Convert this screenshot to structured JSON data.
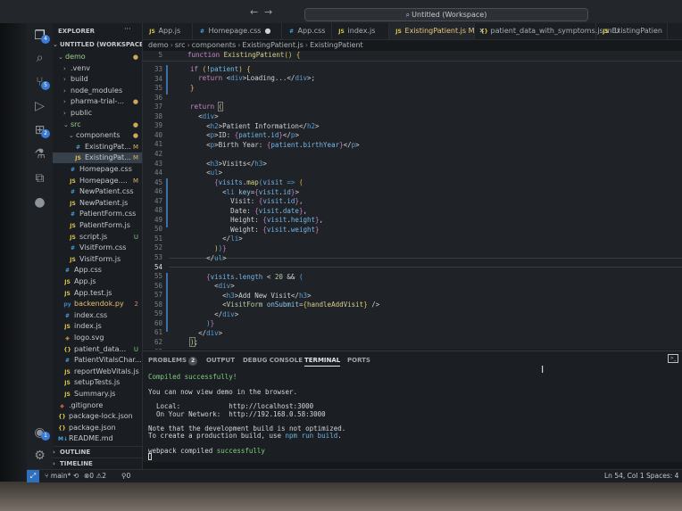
{
  "window": {
    "title": "Untitled (Workspace)"
  },
  "activity_bar": {
    "items": [
      {
        "icon": "files-icon",
        "badge": "4"
      },
      {
        "icon": "search-icon"
      },
      {
        "icon": "source-control-icon",
        "badge": "5"
      },
      {
        "icon": "run-debug-icon"
      },
      {
        "icon": "extensions-icon",
        "badge": "2"
      },
      {
        "icon": "testing-icon"
      },
      {
        "icon": "remote-explorer-icon"
      },
      {
        "icon": "github-icon"
      },
      {
        "icon": "accounts-icon",
        "badge": "1"
      },
      {
        "icon": "manage-gear-icon"
      }
    ]
  },
  "explorer": {
    "header": "EXPLORER",
    "more": "···",
    "workspace": "UNTITLED (WORKSPACE)",
    "tree": [
      {
        "label": "demo",
        "kind": "folder-open",
        "indent": 1,
        "status": "●",
        "status_kind": "dot",
        "highlight": true
      },
      {
        "label": ".venv",
        "kind": "folder",
        "indent": 2
      },
      {
        "label": "build",
        "kind": "folder",
        "indent": 2
      },
      {
        "label": "node_modules",
        "kind": "folder",
        "indent": 2
      },
      {
        "label": "pharma-trial-...",
        "kind": "folder",
        "indent": 2,
        "status": "●",
        "status_kind": "dot"
      },
      {
        "label": "public",
        "kind": "folder",
        "indent": 2
      },
      {
        "label": "src",
        "kind": "folder-open",
        "indent": 2,
        "status": "●",
        "status_kind": "dot",
        "highlight": true
      },
      {
        "label": "components",
        "kind": "folder-open",
        "indent": 3,
        "status": "●",
        "status_kind": "dot"
      },
      {
        "label": "ExistingPat...",
        "file": "css",
        "indent": 4,
        "status": "M",
        "status_kind": "m"
      },
      {
        "label": "ExistingPat...",
        "file": "js",
        "indent": 4,
        "status": "M",
        "status_kind": "m",
        "selected": true
      },
      {
        "label": "Homepage.css",
        "file": "css",
        "indent": 3
      },
      {
        "label": "Homepage....",
        "file": "js",
        "indent": 3,
        "status": "M",
        "status_kind": "m"
      },
      {
        "label": "NewPatient.css",
        "file": "css",
        "indent": 3
      },
      {
        "label": "NewPatient.js",
        "file": "js",
        "indent": 3
      },
      {
        "label": "PatientForm.css",
        "file": "css",
        "indent": 3
      },
      {
        "label": "PatientForm.js",
        "file": "js",
        "indent": 3
      },
      {
        "label": "script.js",
        "file": "js",
        "indent": 3,
        "status": "U",
        "status_kind": "u"
      },
      {
        "label": "VisitForm.css",
        "file": "css",
        "indent": 3
      },
      {
        "label": "VisitForm.js",
        "file": "js",
        "indent": 3
      },
      {
        "label": "App.css",
        "file": "css",
        "indent": 2
      },
      {
        "label": "App.js",
        "file": "js",
        "indent": 2
      },
      {
        "label": "App.test.js",
        "file": "js",
        "indent": 2
      },
      {
        "label": "backendok.py",
        "file": "py",
        "indent": 2,
        "status": "2",
        "status_kind": "err",
        "highlight": true
      },
      {
        "label": "index.css",
        "file": "css",
        "indent": 2
      },
      {
        "label": "index.js",
        "file": "js",
        "indent": 2
      },
      {
        "label": "logo.svg",
        "file": "svg",
        "indent": 2
      },
      {
        "label": "patient_data...",
        "file": "json",
        "indent": 2,
        "status": "U",
        "status_kind": "u"
      },
      {
        "label": "PatientVitalsChar...",
        "file": "css",
        "indent": 2
      },
      {
        "label": "reportWebVitals.js",
        "file": "js",
        "indent": 2
      },
      {
        "label": "setupTests.js",
        "file": "js",
        "indent": 2
      },
      {
        "label": "Summary.js",
        "file": "js",
        "indent": 2
      },
      {
        "label": ".gitignore",
        "file": "git",
        "indent": 1
      },
      {
        "label": "package-lock.json",
        "file": "json",
        "indent": 1
      },
      {
        "label": "package.json",
        "file": "json",
        "indent": 1
      },
      {
        "label": "README.md",
        "file": "md",
        "indent": 1
      }
    ],
    "outline": "OUTLINE",
    "timeline": "TIMELINE"
  },
  "tabs": [
    {
      "label": "App.js",
      "file": "js"
    },
    {
      "label": "Homepage.css",
      "file": "css",
      "modified": "●"
    },
    {
      "label": "App.css",
      "file": "css"
    },
    {
      "label": "index.js",
      "file": "js"
    },
    {
      "label": "ExistingPatient.js M",
      "file": "js",
      "active": true,
      "close": "✕"
    },
    {
      "label": "patient_data_with_symptoms.json U",
      "file": "json"
    },
    {
      "label": "ExistingPatien",
      "file": "js"
    }
  ],
  "breadcrumb": {
    "parts": [
      "demo",
      "src",
      "components",
      "ExistingPatient.js",
      "ExistingPatient"
    ]
  },
  "editor": {
    "sticky_line_number": "5",
    "sticky_code": "function ExistingPatient() {",
    "line_numbers": [
      "33",
      "34",
      "35",
      "36",
      "37",
      "38",
      "39",
      "40",
      "41",
      "42",
      "43",
      "44",
      "45",
      "46",
      "47",
      "48",
      "49",
      "50",
      "51",
      "52",
      "53",
      "54",
      "55",
      "56",
      "57",
      "58",
      "59",
      "60",
      "61",
      "62",
      "63"
    ],
    "current_line": "54"
  },
  "panel": {
    "tabs": [
      {
        "label": "PROBLEMS",
        "badge": "2"
      },
      {
        "label": "OUTPUT"
      },
      {
        "label": "DEBUG CONSOLE"
      },
      {
        "label": "TERMINAL",
        "active": true
      },
      {
        "label": "PORTS"
      }
    ],
    "terminal_lines": [
      {
        "text": "Compiled successfully!",
        "style": "ok"
      },
      {
        "text": "",
        "style": ""
      },
      {
        "text": "You can now view demo in the browser.",
        "style": ""
      },
      {
        "text": "",
        "style": ""
      },
      {
        "text": "  Local:            http://localhost:3000",
        "style": ""
      },
      {
        "text": "  On Your Network:  http://192.168.0.58:3000",
        "style": ""
      },
      {
        "text": "",
        "style": ""
      },
      {
        "text": "Note that the development build is not optimized.",
        "style": ""
      },
      {
        "text": "To create a production build, use npm run build.",
        "style": ""
      },
      {
        "text": "",
        "style": ""
      },
      {
        "text": "webpack compiled successfully",
        "style": ""
      }
    ]
  },
  "status_bar": {
    "branch": "main*",
    "sync": "⟲",
    "errors": "0",
    "warnings": "2",
    "ports": "0",
    "cursor_position": "Ln 54, Col 1",
    "indent": "Spaces: 4"
  }
}
